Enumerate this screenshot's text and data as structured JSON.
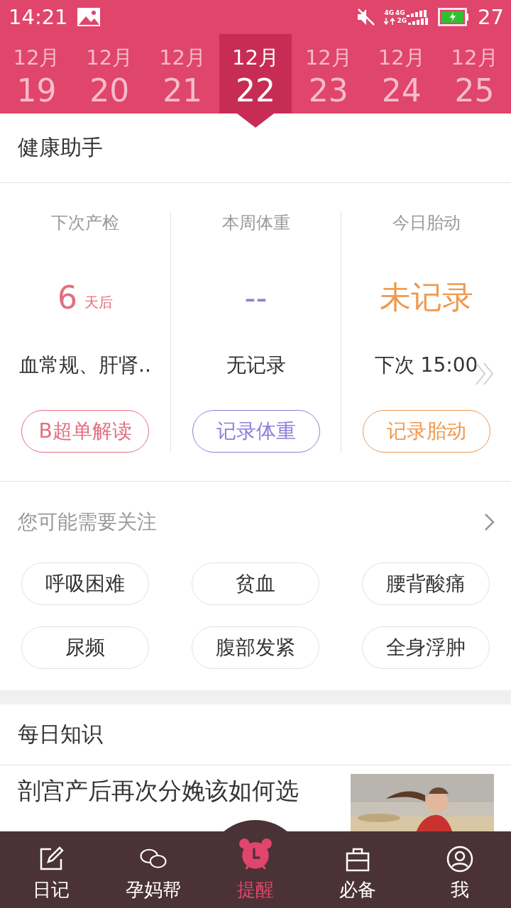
{
  "status_bar": {
    "time": "14:21",
    "network_labels": [
      "4G",
      "4G",
      "2G"
    ],
    "battery": "27"
  },
  "dates": [
    {
      "month": "12月",
      "day": "19",
      "selected": false
    },
    {
      "month": "12月",
      "day": "20",
      "selected": false
    },
    {
      "month": "12月",
      "day": "21",
      "selected": false
    },
    {
      "month": "12月",
      "day": "22",
      "selected": true
    },
    {
      "month": "12月",
      "day": "23",
      "selected": false
    },
    {
      "month": "12月",
      "day": "24",
      "selected": false
    },
    {
      "month": "12月",
      "day": "25",
      "selected": false
    }
  ],
  "health": {
    "title": "健康助手",
    "cards": [
      {
        "title": "下次产检",
        "value": "6",
        "unit": "天后",
        "note": "血常规、肝肾..",
        "button": "B超单解读",
        "color": "#e0707f"
      },
      {
        "title": "本周体重",
        "value": "--",
        "note": "无记录",
        "button": "记录体重",
        "color": "#8a80d8"
      },
      {
        "title": "今日胎动",
        "value": "未记录",
        "note": "下次 15:00",
        "button": "记录胎动",
        "color": "#ee9a4f"
      }
    ]
  },
  "attention": {
    "title": "您可能需要关注",
    "tags": [
      "呼吸困难",
      "贫血",
      "腰背酸痛",
      "尿频",
      "腹部发紧",
      "全身浮肿"
    ]
  },
  "knowledge": {
    "title": "每日知识",
    "articles": [
      {
        "title": "剖宫产后再次分娩该如何选",
        "kind": "picture"
      }
    ]
  },
  "nav": [
    {
      "label": "日记",
      "selected": false
    },
    {
      "label": "孕妈帮",
      "selected": false
    },
    {
      "label": "提醒",
      "selected": true
    },
    {
      "label": "必备",
      "selected": false
    },
    {
      "label": "我",
      "selected": false
    }
  ]
}
